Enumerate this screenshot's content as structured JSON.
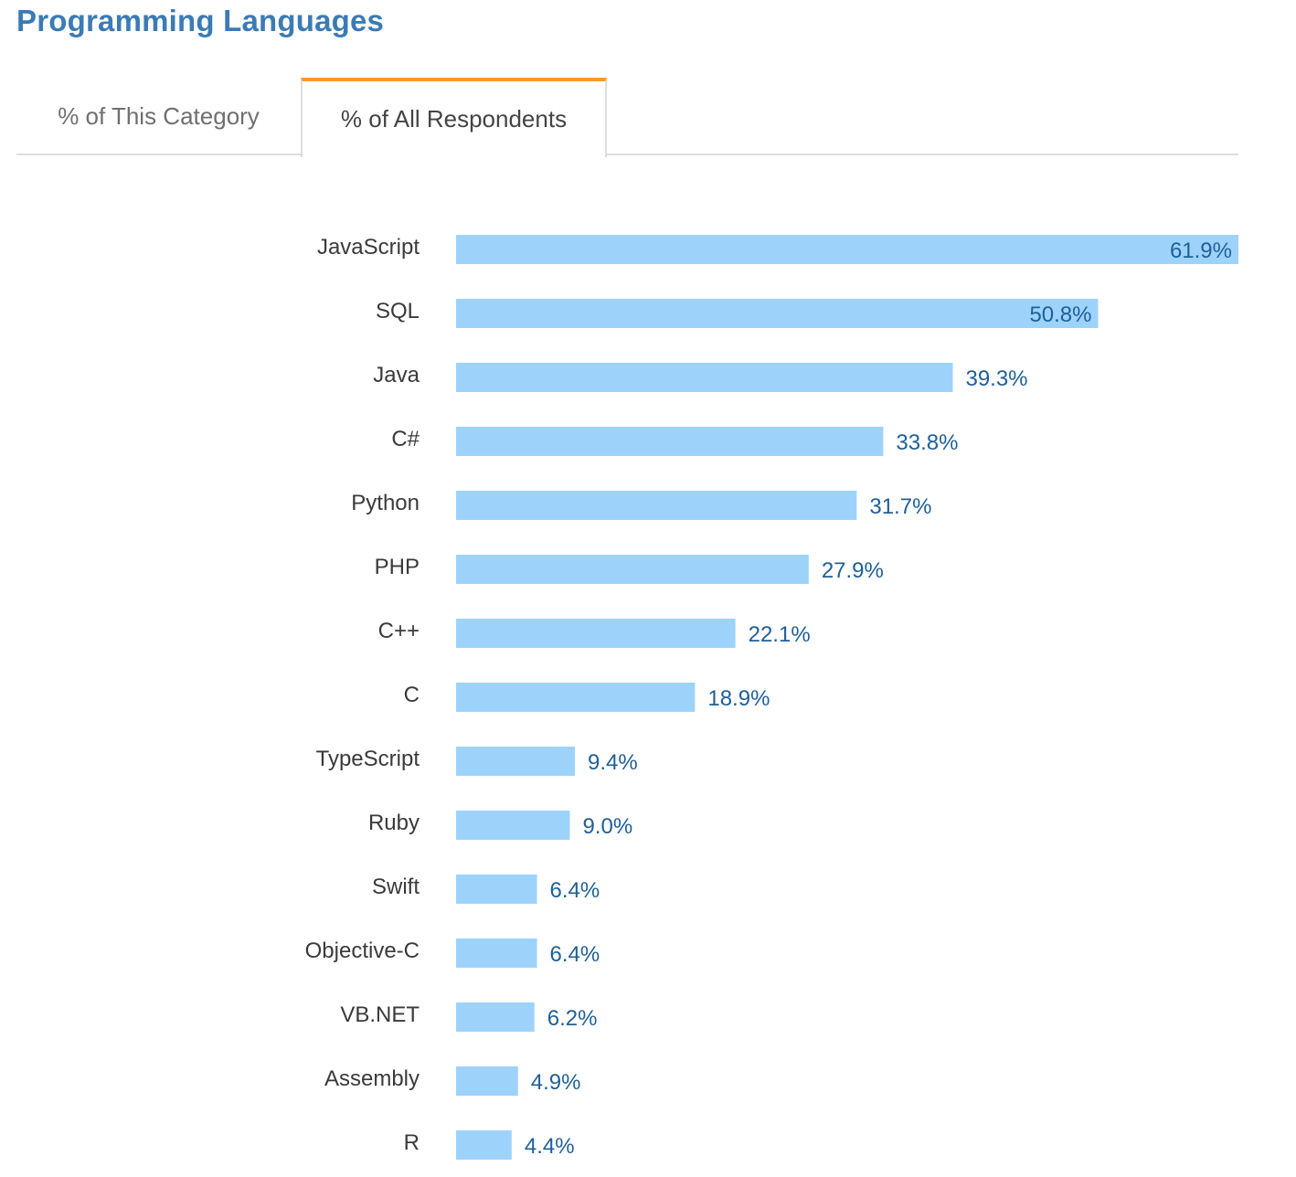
{
  "page": {
    "title": "Programming Languages",
    "tabs": [
      {
        "label": "% of This Category",
        "active": false
      },
      {
        "label": "% of All Respondents",
        "active": true
      }
    ]
  },
  "colors": {
    "title": "#3b7bb5",
    "active_tab_accent": "#f7992b",
    "bar": "#9dd3fb",
    "value_label": "#1f5f99",
    "category_label": "#3a3a3a"
  },
  "chart_data": {
    "type": "bar",
    "orientation": "horizontal",
    "title": "Programming Languages",
    "xlabel": "",
    "ylabel": "",
    "xlim": [
      0,
      61.9
    ],
    "grid": false,
    "legend": "none",
    "categories": [
      "JavaScript",
      "SQL",
      "Java",
      "C#",
      "Python",
      "PHP",
      "C++",
      "C",
      "TypeScript",
      "Ruby",
      "Swift",
      "Objective-C",
      "VB.NET",
      "Assembly",
      "R"
    ],
    "values": [
      61.9,
      50.8,
      39.3,
      33.8,
      31.7,
      27.9,
      22.1,
      18.9,
      9.4,
      9.0,
      6.4,
      6.4,
      6.2,
      4.9,
      4.4
    ],
    "value_labels": [
      "61.9%",
      "50.8%",
      "39.3%",
      "33.8%",
      "31.7%",
      "27.9%",
      "22.1%",
      "18.9%",
      "9.4%",
      "9.0%",
      "6.4%",
      "6.4%",
      "6.2%",
      "4.9%",
      "4.4%"
    ],
    "unit": "%"
  }
}
